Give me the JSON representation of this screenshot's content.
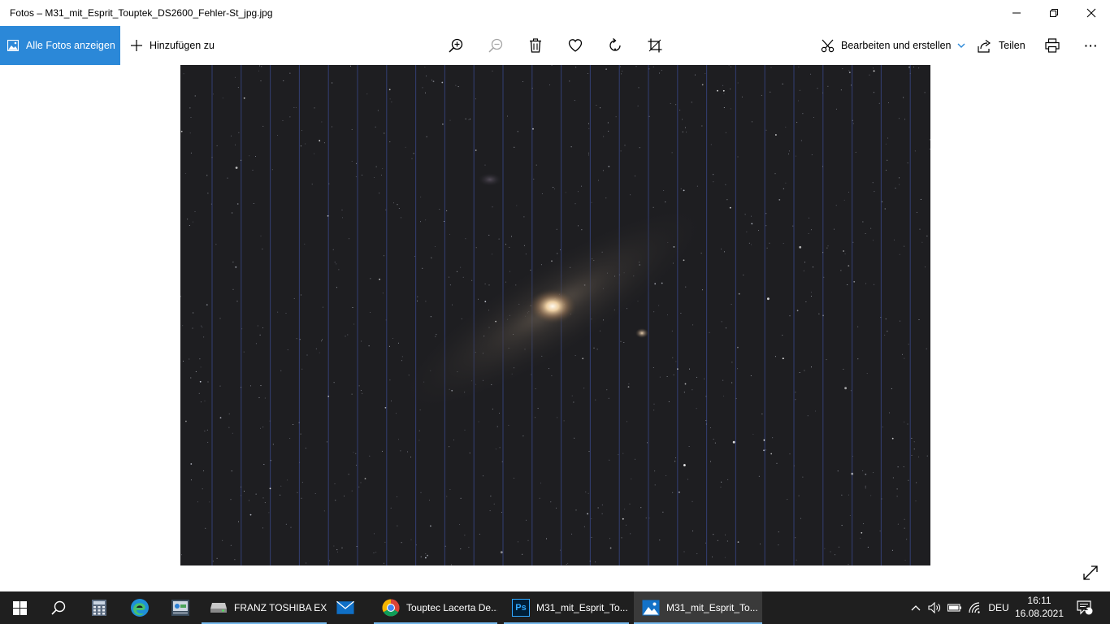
{
  "window": {
    "title": "Fotos – M31_mit_Esprit_Touptek_DS2600_Fehler-St_jpg.jpg"
  },
  "toolbar": {
    "all_photos_label": "Alle Fotos anzeigen",
    "add_to_label": "Hinzufügen zu",
    "edit_create_label": "Bearbeiten und erstellen",
    "share_label": "Teilen",
    "more_label": "···"
  },
  "colors": {
    "accent": "#2b88d8",
    "taskbar": "#1f1f1f",
    "photo_background": "#1e1e21",
    "stripe": "#3a4a8c"
  },
  "taskbar": {
    "apps": [
      {
        "label": "FRANZ TOSHIBA EX...",
        "icon": "drive-icon"
      },
      {
        "label": "Touptec Lacerta De...",
        "icon": "chrome-icon"
      },
      {
        "label": "M31_mit_Esprit_To...",
        "icon": "photoshop-icon"
      },
      {
        "label": "M31_mit_Esprit_To...",
        "icon": "photos-icon"
      }
    ],
    "language": "DEU",
    "time": "16:11",
    "date": "16.08.2021",
    "notification_count": "1",
    "photoshop_badge": "Ps"
  }
}
